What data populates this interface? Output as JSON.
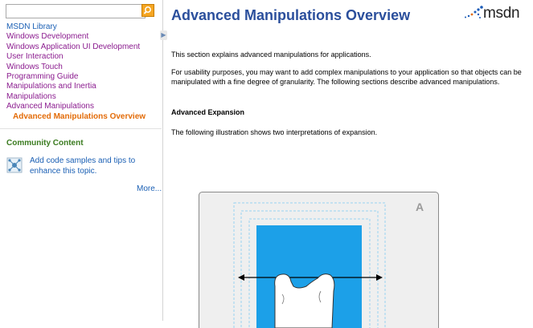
{
  "search": {
    "placeholder": ""
  },
  "sidebar": {
    "nav": [
      {
        "label": "MSDN Library",
        "style": "blue"
      },
      {
        "label": "Windows Development",
        "style": "purple"
      },
      {
        "label": "Windows Application UI Development",
        "style": "purple"
      },
      {
        "label": "User Interaction",
        "style": "purple"
      },
      {
        "label": "Windows Touch",
        "style": "purple"
      },
      {
        "label": "Programming Guide",
        "style": "purple"
      },
      {
        "label": "Manipulations and Inertia",
        "style": "purple"
      },
      {
        "label": "Manipulations",
        "style": "purple"
      },
      {
        "label": "Advanced Manipulations",
        "style": "purple"
      },
      {
        "label": "Advanced Manipulations Overview",
        "style": "active"
      }
    ],
    "community": {
      "title": "Community Content",
      "text": "Add code samples and tips to enhance this topic.",
      "more": "More..."
    }
  },
  "content": {
    "title": "Advanced Manipulations Overview",
    "logo": "msdn",
    "intro": "This section explains advanced manipulations for applications.",
    "para2": "For usability purposes, you may want to add complex manipulations to your application so that objects can be manipulated with a fine degree of granularity. The following sections describe advanced manipulations.",
    "heading": "Advanced Expansion",
    "para3": "The following illustration shows two interpretations of expansion.",
    "illustration_label": "A"
  },
  "colors": {
    "title": "#2b4f9c",
    "nav_visited": "#8b1c8f",
    "nav_active": "#e36c09",
    "community_title": "#3a7b1f",
    "link": "#1a5fb4",
    "illustration_blue": "#1ca0e8"
  }
}
